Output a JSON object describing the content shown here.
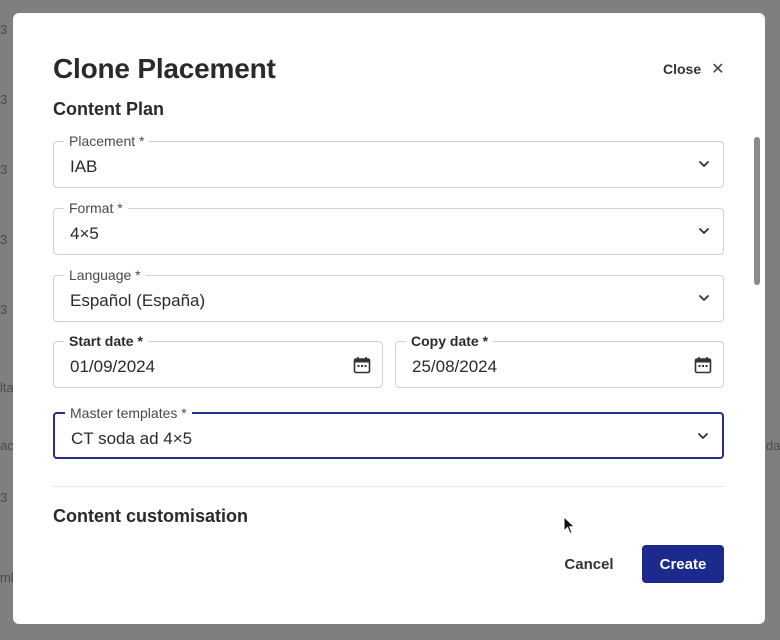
{
  "background": {
    "glyphs": [
      "3",
      "3",
      "3",
      "3",
      "3",
      "lta",
      "3",
      "ac",
      "da",
      "mb"
    ]
  },
  "dialog": {
    "title": "Clone Placement",
    "close_label": "Close",
    "close_icon": "close-icon"
  },
  "content_plan": {
    "heading": "Content Plan",
    "placement": {
      "label": "Placement *",
      "value": "IAB"
    },
    "format": {
      "label": "Format *",
      "value": "4×5"
    },
    "language": {
      "label": "Language *",
      "value": "Español (España)"
    },
    "start_date": {
      "label": "Start date *",
      "value": "01/09/2024"
    },
    "copy_date": {
      "label": "Copy date *",
      "value": "25/08/2024"
    },
    "master_templates": {
      "label": "Master templates *",
      "value": "CT soda ad 4×5"
    }
  },
  "content_customisation": {
    "heading": "Content customisation"
  },
  "footer": {
    "cancel_label": "Cancel",
    "create_label": "Create"
  },
  "colors": {
    "primary": "#1c2a8c",
    "focus_border": "#24308a",
    "field_border": "#cfd2d9",
    "overlay": "#7f7f7f"
  }
}
